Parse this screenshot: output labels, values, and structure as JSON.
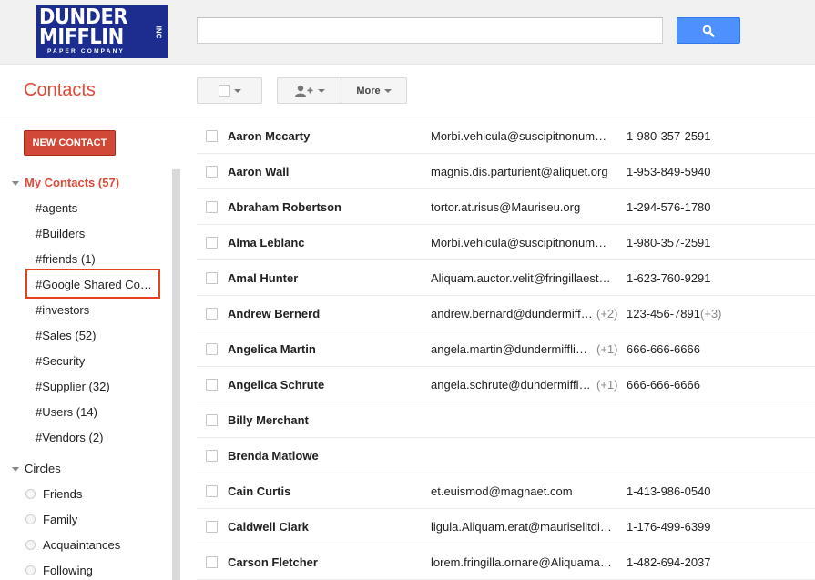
{
  "logo": {
    "line1": "DUNDER",
    "line2": "MIFFLIN",
    "inc": "INC",
    "line3": "PAPER COMPANY"
  },
  "search": {
    "value": "",
    "placeholder": "",
    "button_icon": "search-icon"
  },
  "page_title": "Contacts",
  "toolbar": {
    "more_label": "More",
    "add_icon": "add-person-icon"
  },
  "new_contact_label": "NEW CONTACT",
  "sidebar": {
    "my_contacts": "My Contacts (57)",
    "groups": [
      "#agents",
      "#Builders",
      "#friends (1)",
      "#Google Shared Co…",
      "#investors",
      "#Sales (52)",
      "#Security",
      "#Supplier (32)",
      "#Users (14)",
      "#Vendors (2)"
    ],
    "circles_label": "Circles",
    "circles": [
      "Friends",
      "Family",
      "Acquaintances",
      "Following"
    ]
  },
  "contacts": [
    {
      "name": "Aaron Mccarty",
      "email": "Morbi.vehicula@suscipitnonummy.com",
      "email_more": "",
      "phone": "1-980-357-2591",
      "phone_more": ""
    },
    {
      "name": "Aaron Wall",
      "email": "magnis.dis.parturient@aliquet.org",
      "email_more": "",
      "phone": "1-953-849-5940",
      "phone_more": ""
    },
    {
      "name": "Abraham Robertson",
      "email": "tortor.at.risus@Mauriseu.org",
      "email_more": "",
      "phone": "1-294-576-1780",
      "phone_more": ""
    },
    {
      "name": "Alma Leblanc",
      "email": "Morbi.vehicula@suscipitnonummy.com",
      "email_more": "",
      "phone": "1-980-357-2591",
      "phone_more": ""
    },
    {
      "name": "Amal Hunter",
      "email": "Aliquam.auctor.velit@fringillaest.ca",
      "email_more": "",
      "phone": "1-623-760-9291",
      "phone_more": ""
    },
    {
      "name": "Andrew Bernerd",
      "email": "andrew.bernard@dundermifflin.com",
      "email_more": "(+2)",
      "phone": "123-456-7891",
      "phone_more": "(+3)"
    },
    {
      "name": "Angelica Martin",
      "email": "angela.martin@dundermifflin.com",
      "email_more": "(+1)",
      "phone": "666-666-6666",
      "phone_more": ""
    },
    {
      "name": "Angelica Schrute",
      "email": "angela.schrute@dundermifflin.com",
      "email_more": "(+1)",
      "phone": "666-666-6666",
      "phone_more": ""
    },
    {
      "name": "Billy Merchant",
      "email": "",
      "email_more": "",
      "phone": "",
      "phone_more": ""
    },
    {
      "name": "Brenda Matlowe",
      "email": "",
      "email_more": "",
      "phone": "",
      "phone_more": ""
    },
    {
      "name": "Cain Curtis",
      "email": "et.euismod@magnaet.com",
      "email_more": "",
      "phone": "1-413-986-0540",
      "phone_more": ""
    },
    {
      "name": "Caldwell Clark",
      "email": "ligula.Aliquam.erat@mauriselitdictum.com",
      "email_more": "",
      "phone": "1-176-499-6399",
      "phone_more": ""
    },
    {
      "name": "Carson Fletcher",
      "email": "lorem.fringilla.ornare@Aliquamadipiscing.com",
      "email_more": "",
      "phone": "1-482-694-2037",
      "phone_more": ""
    }
  ],
  "colors": {
    "accent": "#dd4b39",
    "button_red": "#d14836",
    "search_blue": "#4d90fe",
    "highlight_border": "#e8401c"
  }
}
